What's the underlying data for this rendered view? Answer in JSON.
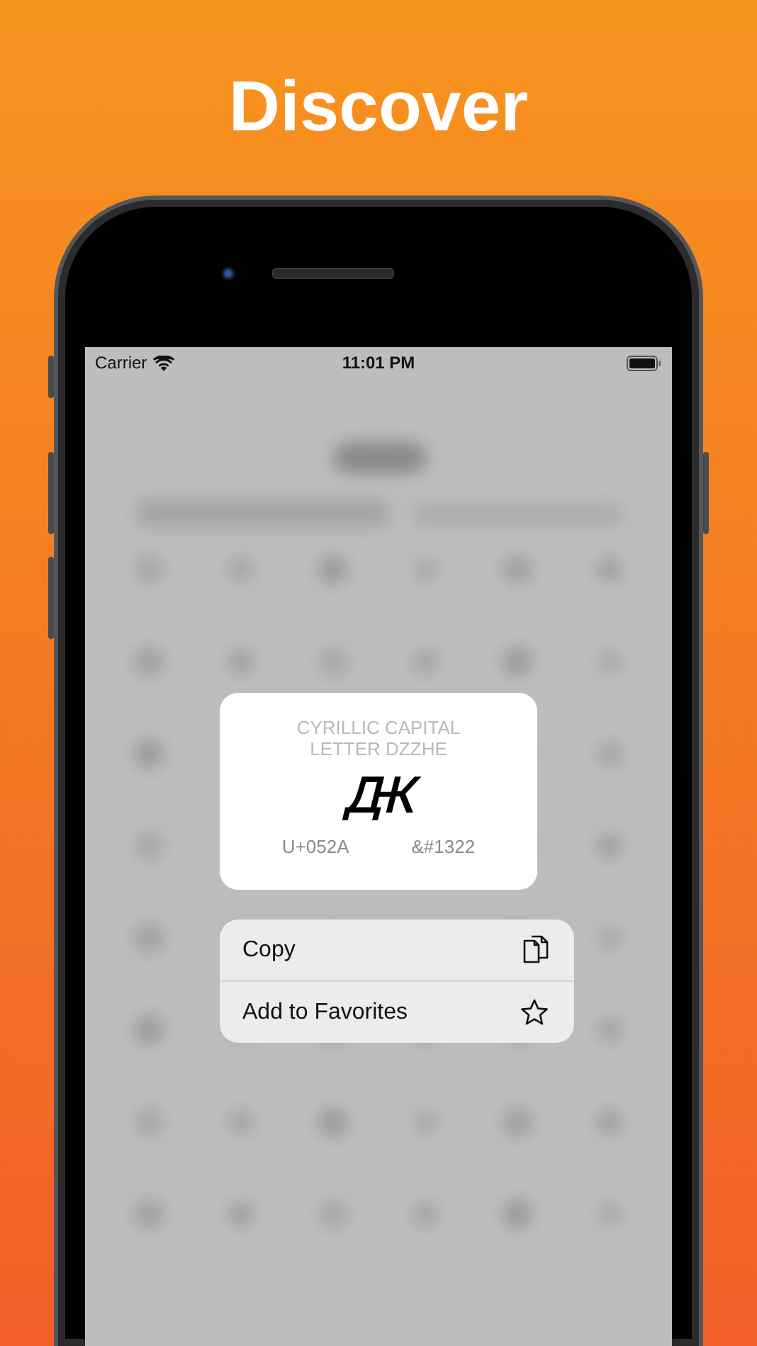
{
  "headline": "Discover",
  "status_bar": {
    "carrier": "Carrier",
    "time": "11:01 PM"
  },
  "character_card": {
    "name": "CYRILLIC CAPITAL LETTER DZZHE",
    "glyph": "Ԫ",
    "code_point": "U+052A",
    "html_entity": "&#1322"
  },
  "context_menu": [
    {
      "label": "Copy",
      "kind": "copy"
    },
    {
      "label": "Add to Favorites",
      "kind": "favorite"
    }
  ]
}
